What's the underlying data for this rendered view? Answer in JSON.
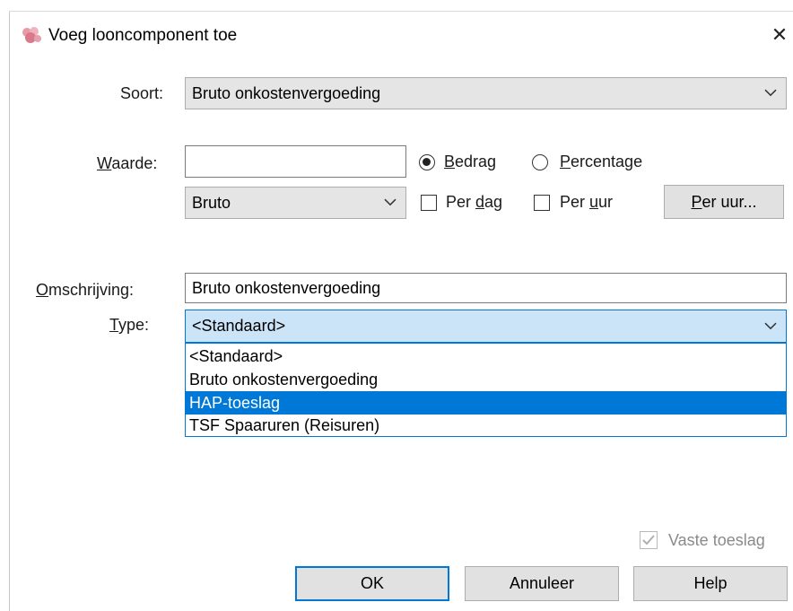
{
  "window": {
    "title": "Voeg looncomponent toe",
    "close_glyph": "✕"
  },
  "soort": {
    "label": "Soort:",
    "value": "Bruto onkostenvergoeding"
  },
  "waarde": {
    "label_accel": "W",
    "label_rest": "aarde:",
    "value": ""
  },
  "bedrag_radio": {
    "accel": "B",
    "rest": "edrag",
    "checked": true
  },
  "percentage_radio": {
    "accel": "P",
    "rest": "ercentage",
    "checked": false
  },
  "bruto_combo": {
    "value": "Bruto"
  },
  "per_dag": {
    "pre": "Per ",
    "accel": "d",
    "post": "ag",
    "checked": false
  },
  "per_uur": {
    "pre": "Per ",
    "accel": "u",
    "post": "ur",
    "checked": false
  },
  "per_uur_button": {
    "accel": "P",
    "rest": "er uur..."
  },
  "omschrijving": {
    "label_accel": "O",
    "label_rest": "mschrijving:",
    "value": "Bruto onkostenvergoeding"
  },
  "type": {
    "label_accel": "T",
    "label_rest": "ype:",
    "value": "<Standaard>",
    "options": [
      "<Standaard>",
      "Bruto onkostenvergoeding",
      "HAP-toeslag",
      "TSF Spaaruren (Reisuren)"
    ],
    "highlighted_index": 2
  },
  "vaste_toeslag": {
    "label": "Vaste toeslag",
    "checked": true,
    "disabled": true
  },
  "buttons": {
    "ok": "OK",
    "annuleer": "Annuleer",
    "help": "Help"
  },
  "colors": {
    "accent": "#0078d7",
    "combo_bg": "#e5e5e5",
    "active_combo_bg": "#cce4f7"
  },
  "icons": {
    "title_icon": "pink-flower-icon",
    "chevron": "chevron-down-icon"
  }
}
